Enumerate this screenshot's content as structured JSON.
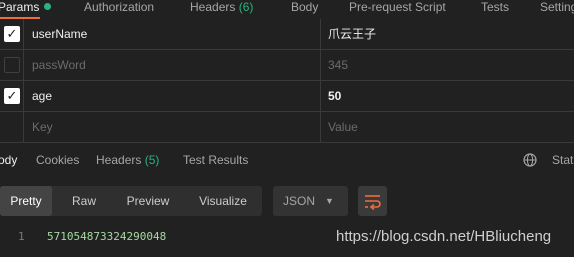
{
  "request_tabs": {
    "params": "Params",
    "authorization": "Authorization",
    "headers": "Headers",
    "headers_count": "(6)",
    "body": "Body",
    "prerequest": "Pre-request Script",
    "tests": "Tests",
    "settings": "Settings"
  },
  "params": [
    {
      "checked": true,
      "key": "userName",
      "value": "爪云王子"
    },
    {
      "checked": false,
      "key": "passWord",
      "value": "345"
    },
    {
      "checked": true,
      "key": "age",
      "value": "50"
    }
  ],
  "params_placeholder": {
    "key": "Key",
    "value": "Value"
  },
  "response_tabs": {
    "body": "Body",
    "cookies": "Cookies",
    "headers": "Headers",
    "headers_count": "(5)",
    "test_results": "Test Results",
    "status": "Status"
  },
  "view_modes": {
    "pretty": "Pretty",
    "raw": "Raw",
    "preview": "Preview",
    "visualize": "Visualize",
    "active": "Pretty"
  },
  "format": {
    "selected": "JSON"
  },
  "code": {
    "line_number": "1",
    "value": "571054873324290048"
  },
  "watermark": "https://blog.csdn.net/HBliucheng",
  "colors": {
    "accent": "#f26b3a",
    "count_green": "#26b47f",
    "background": "#212121"
  }
}
